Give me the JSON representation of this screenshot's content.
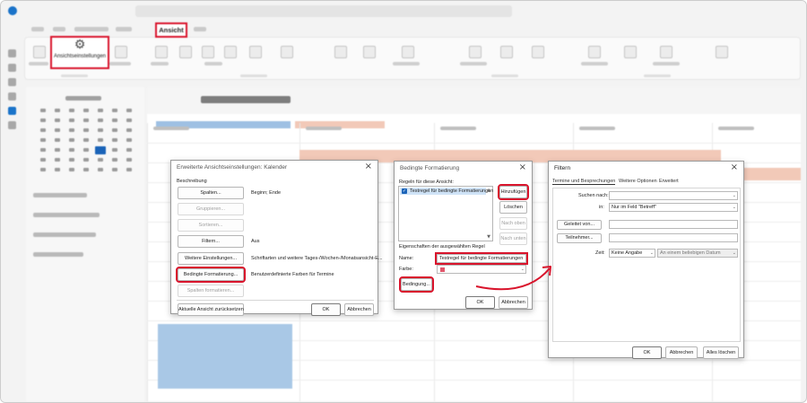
{
  "ribbon": {
    "active_tab": "Ansicht",
    "view_settings_label": "Ansichtseinstellungen",
    "view_settings_icon": "gear-icon"
  },
  "dialog_advanced": {
    "title": "Erweiterte Ansichtseinstellungen: Kalender",
    "section": "Beschreibung",
    "rows": [
      {
        "button": "Spalten...",
        "value": "Beginn; Ende",
        "enabled": true
      },
      {
        "button": "Gruppieren...",
        "value": "",
        "enabled": false
      },
      {
        "button": "Sortieren...",
        "value": "",
        "enabled": false
      },
      {
        "button": "Filtern...",
        "value": "Aus",
        "enabled": true
      },
      {
        "button": "Weitere Einstellungen...",
        "value": "Schriftarten und weitere Tages-/Wochen-/Monatsansicht-E...",
        "enabled": true
      },
      {
        "button": "Bedingte Formatierung...",
        "value": "Benutzerdefinierte Farben für Termine",
        "enabled": true
      },
      {
        "button": "Spalten formatieren...",
        "value": "",
        "enabled": false
      }
    ],
    "reset_label": "Aktuelle Ansicht zurücksetzen",
    "ok_label": "OK",
    "cancel_label": "Abbrechen"
  },
  "dialog_conditional": {
    "title": "Bedingte Formatierung",
    "rules_label": "Regeln für diese Ansicht:",
    "rule_item": "Testregel für bedingte Formatierungen",
    "add_label": "Hinzufügen",
    "delete_label": "Löschen",
    "up_label": "Nach oben",
    "down_label": "Nach unten",
    "props_label": "Eigenschaften der ausgewählten Regel",
    "name_label": "Name:",
    "name_value": "Testregel für bedingte Formatierungen",
    "color_label": "Farbe:",
    "condition_label": "Bedingung...",
    "ok_label": "OK",
    "cancel_label": "Abbrechen",
    "swatch_color": "#e1566b"
  },
  "dialog_filter": {
    "title": "Filtern",
    "tabs": [
      "Termine und Besprechungen",
      "Weitere Optionen",
      "Erweitert"
    ],
    "search_label": "Suchen nach:",
    "search_value": "",
    "in_label": "in:",
    "in_value": "Nur im Feld \"Betreff\"",
    "organized_by_label": "Geleitet von...",
    "attendees_label": "Teilnehmer...",
    "time_label": "Zeit:",
    "time_value": "Keine Angabe",
    "time_range_value": "An einem beliebigen Datum",
    "ok_label": "OK",
    "cancel_label": "Abbrechen",
    "clear_label": "Alles löschen"
  },
  "colors": {
    "highlight": "#d9142c",
    "accent": "#1a63b8"
  }
}
